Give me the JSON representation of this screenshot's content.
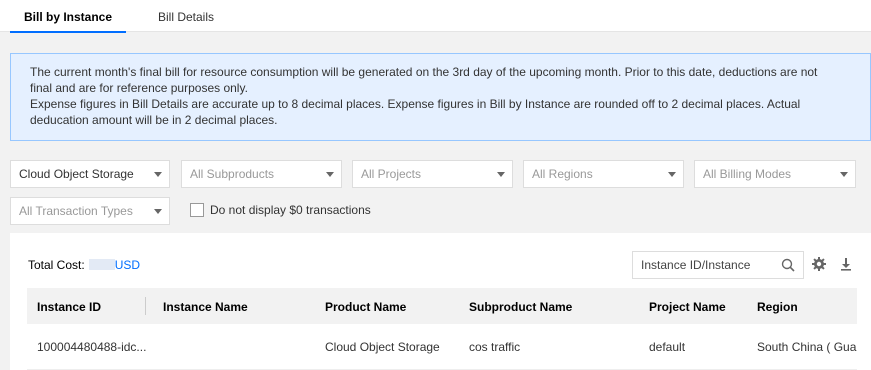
{
  "tabs": [
    {
      "label": "Bill by Instance",
      "active": true
    },
    {
      "label": "Bill Details",
      "active": false
    }
  ],
  "notice": {
    "line1": "The current month's final bill for resource consumption will be generated on the 3rd day of the upcoming month. Prior to this date, deductions are not",
    "line2": "final and are for reference purposes only.",
    "line3": "Expense figures in Bill Details are accurate up to 8 decimal places. Expense figures in Bill by Instance are rounded off to 2 decimal places. Actual",
    "line4": "deducation amount will be in 2 decimal places."
  },
  "filters": {
    "product": "Cloud Object Storage",
    "subproduct": "All Subproducts",
    "project": "All Projects",
    "region": "All Regions",
    "billing_mode": "All Billing Modes",
    "transaction_type": "All Transaction Types",
    "hide_zero_label": "Do not display $0 transactions",
    "hide_zero_checked": false
  },
  "summary": {
    "total_label": "Total Cost:",
    "currency": "USD"
  },
  "search": {
    "placeholder": "Instance ID/Instance"
  },
  "table": {
    "columns": [
      "Instance ID",
      "Instance Name",
      "Product Name",
      "Subproduct Name",
      "Project Name",
      "Region"
    ],
    "rows": [
      {
        "instance_id": "100004480488-idc...",
        "instance_name": "",
        "product_name": "Cloud Object Storage",
        "subproduct_name": "cos traffic",
        "project_name": "default",
        "region": "South China ( Guan"
      }
    ]
  },
  "colors": {
    "accent": "#006eff",
    "notice_bg": "#e5f0ff",
    "notice_border": "#97c7ff"
  },
  "icons": {
    "search": "search-icon",
    "settings": "gear-icon",
    "download": "download-icon"
  }
}
